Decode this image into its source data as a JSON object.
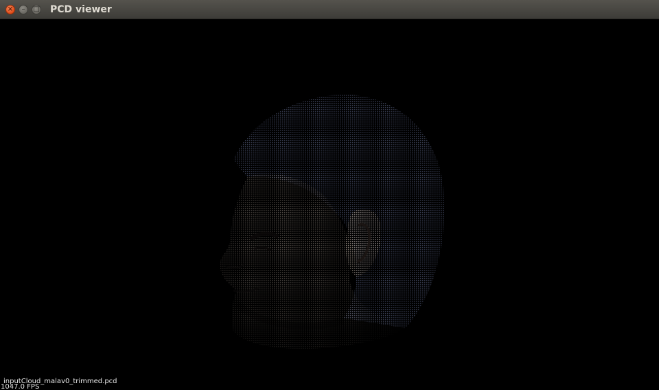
{
  "window": {
    "title": "PCD viewer",
    "controls": {
      "close_glyph": "×",
      "minimize_glyph": "–",
      "maximize_glyph": "□"
    }
  },
  "viewport": {
    "cloud_file": "inputCloud_malav0_trimmed.pcd",
    "fps": "1047.0 FPS",
    "background_color": "#000000"
  },
  "colors": {
    "close_button": "#df4a16",
    "titlebar": "#3d3c38",
    "title_text": "#dfdbd2"
  }
}
